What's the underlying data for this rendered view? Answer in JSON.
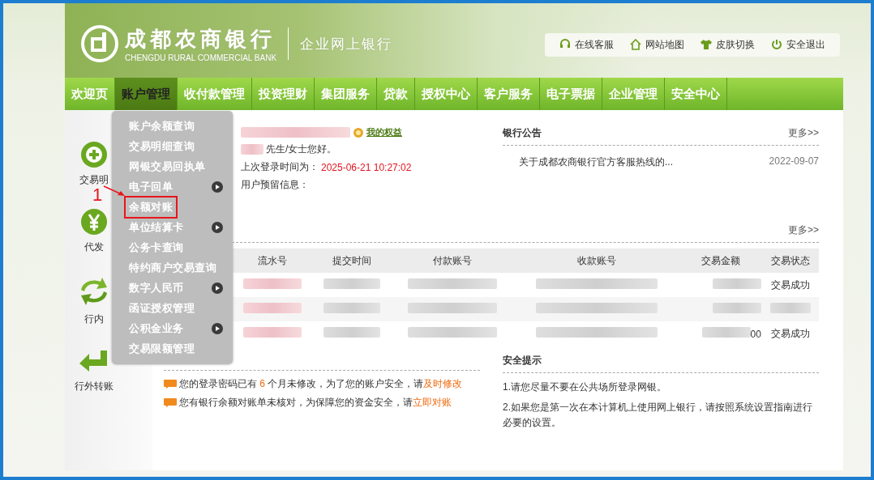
{
  "logo": {
    "name": "成都农商银行",
    "english": "CHENGDU RURAL COMMERCIAL BANK",
    "product": "企业网上银行"
  },
  "toolbar": [
    {
      "kind": "headset",
      "label": "在线客服"
    },
    {
      "kind": "home",
      "label": "网站地图"
    },
    {
      "kind": "shirt",
      "label": "皮肤切换"
    },
    {
      "kind": "power",
      "label": "安全退出"
    }
  ],
  "nav": [
    {
      "label": "欢迎页",
      "selected": false
    },
    {
      "label": "账户管理",
      "selected": true
    },
    {
      "label": "收付款管理",
      "selected": false
    },
    {
      "label": "投资理财",
      "selected": false
    },
    {
      "label": "集团服务",
      "selected": false
    },
    {
      "label": "贷款",
      "selected": false
    },
    {
      "label": "授权中心",
      "selected": false
    },
    {
      "label": "客户服务",
      "selected": false
    },
    {
      "label": "电子票据",
      "selected": false
    },
    {
      "label": "企业管理",
      "selected": false
    },
    {
      "label": "安全中心",
      "selected": false
    }
  ],
  "quick_links": [
    {
      "kind": "plus",
      "label": "交易明"
    },
    {
      "kind": "yen",
      "label": "代发"
    },
    {
      "kind": "swap",
      "label": "行内"
    },
    {
      "kind": "return",
      "label": "行外转账"
    }
  ],
  "menu": [
    {
      "label": "账户余额查询",
      "submenu": false,
      "highlighted": false
    },
    {
      "label": "交易明细查询",
      "submenu": false,
      "highlighted": false
    },
    {
      "label": "网银交易回执单",
      "submenu": false,
      "highlighted": false
    },
    {
      "label": "电子回单",
      "submenu": true,
      "highlighted": false
    },
    {
      "label": "余额对账",
      "submenu": false,
      "highlighted": true
    },
    {
      "label": "单位结算卡",
      "submenu": true,
      "highlighted": false
    },
    {
      "label": "公务卡查询",
      "submenu": false,
      "highlighted": false
    },
    {
      "label": "特约商户交易查询",
      "submenu": false,
      "highlighted": false
    },
    {
      "label": "数字人民币",
      "submenu": true,
      "highlighted": false
    },
    {
      "label": "函证授权管理",
      "submenu": false,
      "highlighted": false
    },
    {
      "label": "公积金业务",
      "submenu": true,
      "highlighted": false
    },
    {
      "label": "交易限额管理",
      "submenu": false,
      "highlighted": false
    }
  ],
  "annotation": {
    "label": "1"
  },
  "user": {
    "benefits_link": "我的权益",
    "greeting": "先生/女士您好。",
    "last_login_label": "上次登录时间为：",
    "last_login_value": "2025-06-21 10:27:02",
    "reserved_info_label": "用户预留信息："
  },
  "announcements": {
    "title": "银行公告",
    "more": "更多>>",
    "items": [
      {
        "text": "关于成都农商银行官方客服热线的...",
        "date": "2022-09-07"
      }
    ]
  },
  "transactions": {
    "more": "更多>>",
    "columns": [
      "流水号",
      "提交时间",
      "付款账号",
      "收款账号",
      "交易金额",
      "交易状态"
    ],
    "rows": [
      {
        "amount_tail": "",
        "status": "交易成功"
      },
      {
        "amount_tail": "",
        "status": ""
      },
      {
        "amount_tail": "00",
        "status": "交易成功"
      }
    ]
  },
  "todo": {
    "items": [
      {
        "parts": [
          "您的登录密码已有 ",
          "6",
          " 个月未修改，为了您的账户安全，请"
        ],
        "link": "及时修改"
      },
      {
        "parts": [
          "您有银行余额对账单未核对，为保障您的资金安全，请"
        ],
        "link": "立即对账"
      }
    ]
  },
  "security": {
    "title": "安全提示",
    "items": [
      "1.请您尽量不要在公共场所登录网银。",
      "2.如果您是第一次在本计算机上使用网上银行，请按照系统设置指南进行必要的设置。"
    ]
  }
}
